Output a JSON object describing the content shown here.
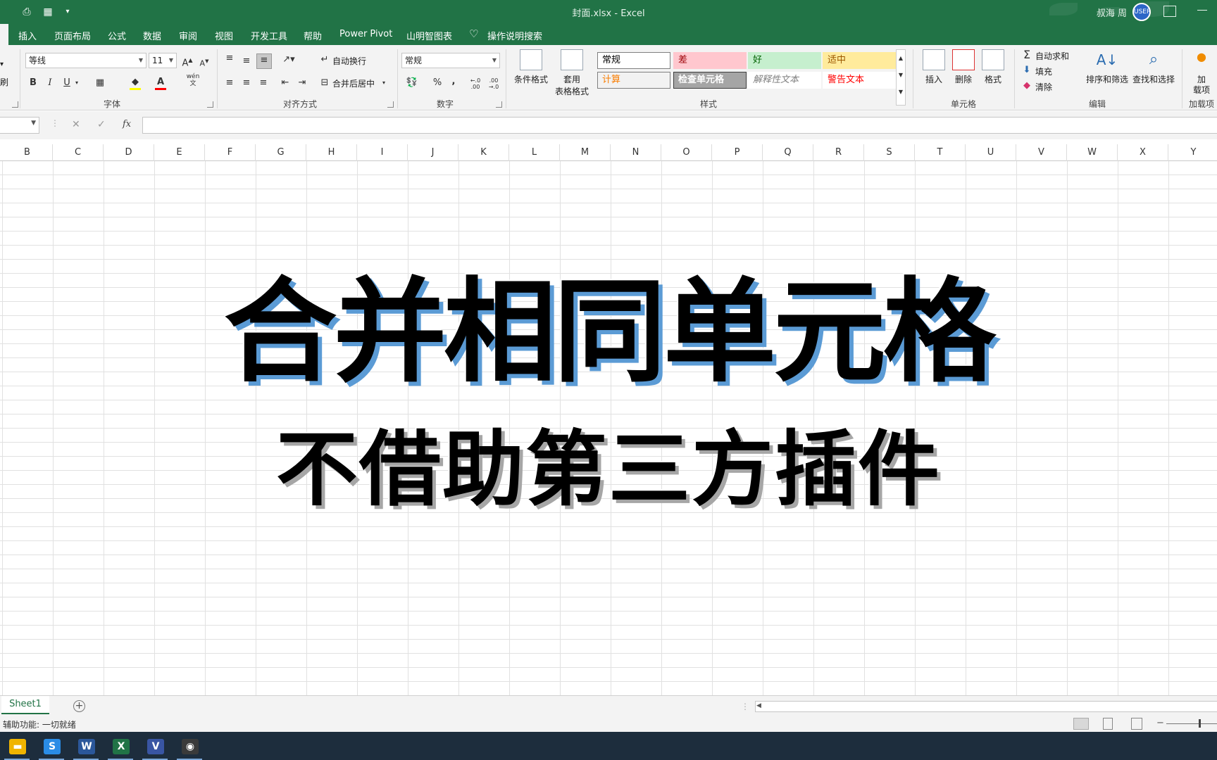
{
  "window": {
    "title": "封面.xlsx  -  Excel",
    "user_name": "叔海 周",
    "avatar_text": "USER"
  },
  "menu": {
    "tabs": [
      "插入",
      "页面布局",
      "公式",
      "数据",
      "审阅",
      "视图",
      "开发工具",
      "帮助",
      "Power Pivot",
      "山明智图表"
    ],
    "search_label": "操作说明搜索"
  },
  "ribbon": {
    "clipboard_label_fragment": "刷",
    "font": {
      "name": "等线",
      "size": "11",
      "group_label": "字体",
      "bold": "B",
      "italic": "I",
      "underline": "U",
      "phonetic": "wén\n文"
    },
    "alignment": {
      "wrap_text": "自动换行",
      "merge_center": "合并后居中",
      "group_label": "对齐方式"
    },
    "number": {
      "format": "常规",
      "group_label": "数字",
      "percent": "%",
      "comma": ",",
      "inc_decimal": "←.0 .00",
      "dec_decimal": ".00 →.0"
    },
    "styles": {
      "conditional_format": "条件格式",
      "format_as_table_line1": "套用",
      "format_as_table_line2": "表格格式",
      "cells": [
        {
          "label": "常规",
          "bg": "#ffffff",
          "fg": "#000000",
          "border": "#7f7f7f"
        },
        {
          "label": "差",
          "bg": "#ffc7ce",
          "fg": "#9c0006",
          "border": "#ffc7ce"
        },
        {
          "label": "好",
          "bg": "#c6efce",
          "fg": "#006100",
          "border": "#c6efce"
        },
        {
          "label": "适中",
          "bg": "#ffeb9c",
          "fg": "#9c5700",
          "border": "#ffeb9c"
        },
        {
          "label": "计算",
          "bg": "#f2f2f2",
          "fg": "#fa7d00",
          "border": "#7f7f7f"
        },
        {
          "label": "检查单元格",
          "bg": "#a5a5a5",
          "fg": "#ffffff",
          "border": "#3f3f3f"
        },
        {
          "label": "解释性文本",
          "bg": "#ffffff",
          "fg": "#7f7f7f",
          "border": "#ffffff"
        },
        {
          "label": "警告文本",
          "bg": "#ffffff",
          "fg": "#ff0000",
          "border": "#ffffff"
        }
      ],
      "group_label": "样式"
    },
    "cells_group": {
      "insert": "插入",
      "delete": "删除",
      "format": "格式",
      "group_label": "单元格"
    },
    "editing": {
      "autosum": "自动求和",
      "fill": "填充",
      "clear": "清除",
      "sort_filter": "排序和筛选",
      "find_select": "查找和选择",
      "group_label": "编辑"
    },
    "addins": {
      "button_line1": "加",
      "button_line2": "载项",
      "group_label": "加载项"
    }
  },
  "formula_bar": {
    "fx": "fx",
    "cancel": "✕",
    "enter": "✓",
    "value": ""
  },
  "columns": [
    "B",
    "C",
    "D",
    "E",
    "F",
    "G",
    "H",
    "I",
    "J",
    "K",
    "L",
    "M",
    "N",
    "O",
    "P",
    "Q",
    "R",
    "S",
    "T",
    "U",
    "V",
    "W",
    "X",
    "Y"
  ],
  "content": {
    "headline": "合并相同单元格",
    "subline": "不借助第三方插件"
  },
  "sheets": {
    "active": "Sheet1"
  },
  "status": {
    "text": "辅助功能: 一切就绪"
  },
  "taskbar": {
    "apps": [
      {
        "name": "file-explorer",
        "color": "#f0b400",
        "glyph": "▬"
      },
      {
        "name": "sogou",
        "color": "#2a8ce6",
        "glyph": "S"
      },
      {
        "name": "word",
        "color": "#2b579a",
        "glyph": "W"
      },
      {
        "name": "excel",
        "color": "#217346",
        "glyph": "X"
      },
      {
        "name": "visio",
        "color": "#3955a3",
        "glyph": "V"
      },
      {
        "name": "screen-recorder",
        "color": "#3a3a3a",
        "glyph": "◉"
      }
    ]
  }
}
